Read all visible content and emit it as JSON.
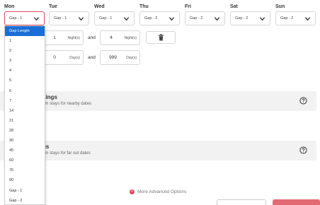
{
  "days": [
    {
      "label": "Mon",
      "value": "Gap - 1"
    },
    {
      "label": "Tue",
      "value": "Gap - 1"
    },
    {
      "label": "Wed",
      "value": "Gap - 1"
    },
    {
      "label": "Thu",
      "value": "Gap - 2"
    },
    {
      "label": "Fri",
      "value": "Gap - 2"
    },
    {
      "label": "Sat",
      "value": "Gap - 2"
    },
    {
      "label": "Sun",
      "value": "Gap - 2"
    }
  ],
  "nights_row": {
    "min": "1",
    "min_unit": "Night(s)",
    "and": "and",
    "max": "4",
    "max_unit": "Night(s)"
  },
  "days_row": {
    "min": "0",
    "min_unit": "Day(s)",
    "and": "and",
    "max": "999",
    "max_unit": "Day(s)"
  },
  "sections": [
    {
      "title": "kings",
      "subtitle": "em stays for nearby dates"
    },
    {
      "title": "gs",
      "subtitle": "em stays for far out dates"
    }
  ],
  "dropdown": {
    "options": [
      "Gap Length",
      "1",
      "2",
      "3",
      "4",
      "5",
      "6",
      "7",
      "14",
      "21",
      "28",
      "30",
      "45",
      "60",
      "76",
      "90",
      "Gap - 1",
      "Gap - 2"
    ],
    "highlighted": "Gap Length"
  },
  "more_options": "More Advanced Options",
  "colors": {
    "accent": "#e04a5a",
    "highlight": "#1a6ed8"
  }
}
